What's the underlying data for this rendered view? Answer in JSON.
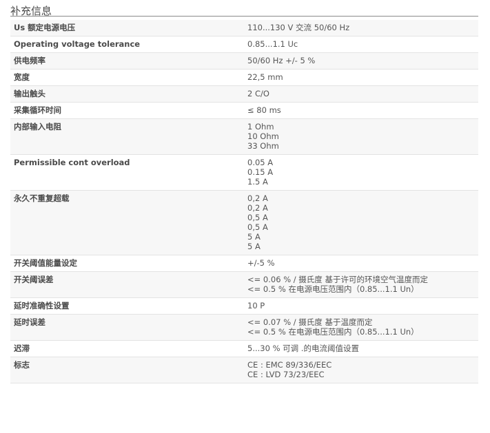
{
  "section_title": "补充信息",
  "rows": [
    {
      "label": "Us 额定电源电压",
      "values": [
        "110...130 V 交流 50/60 Hz"
      ]
    },
    {
      "label": "Operating voltage tolerance",
      "values": [
        "0.85...1.1 Uc"
      ]
    },
    {
      "label": "供电频率",
      "values": [
        "50/60 Hz +/- 5 %"
      ]
    },
    {
      "label": "宽度",
      "values": [
        "22,5 mm"
      ]
    },
    {
      "label": "输出触头",
      "values": [
        "2 C/O"
      ]
    },
    {
      "label": "采集循环时间",
      "values": [
        "≤ 80 ms"
      ]
    },
    {
      "label": "内部输入电阻",
      "values": [
        "1 Ohm",
        "10 Ohm",
        "33 Ohm"
      ]
    },
    {
      "label": "Permissible cont overload",
      "values": [
        "0.05 A",
        "0.15 A",
        "1.5 A"
      ]
    },
    {
      "label": "永久不重复超载",
      "values": [
        "0,2 A",
        "0,2 A",
        "0,5 A",
        "0,5 A",
        "5 A",
        "5 A"
      ]
    },
    {
      "label": "开关阈值能量设定",
      "values": [
        "+/-5 %"
      ]
    },
    {
      "label": "开关阈误差",
      "values": [
        "<= 0.06 % / 摄氏度 基于许可的环境空气温度而定",
        "<= 0.5 % 在电源电压范围内（0.85...1.1 Un）"
      ]
    },
    {
      "label": "延时准确性设置",
      "values": [
        "10 P"
      ]
    },
    {
      "label": "延时误差",
      "values": [
        "<= 0.07 % / 摄氏度 基于温度而定",
        "<= 0.5 % 在电源电压范围内（0.85...1.1 Un）"
      ]
    },
    {
      "label": "迟滞",
      "values": [
        "5...30 % 可调 .的电流阈值设置"
      ]
    },
    {
      "label": "标志",
      "values": [
        "CE : EMC 89/336/EEC",
        "CE : LVD 73/23/EEC"
      ]
    }
  ]
}
